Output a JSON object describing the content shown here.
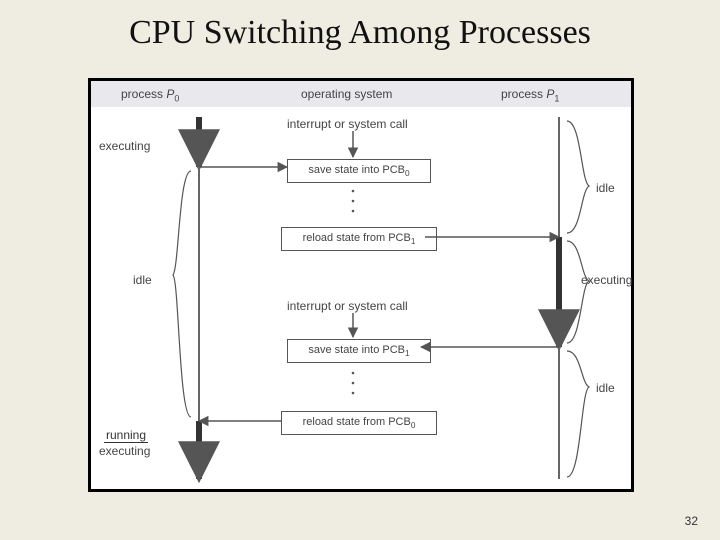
{
  "title": "CPU Switching Among Processes",
  "page_number": "32",
  "columns": {
    "p0": {
      "label": "process ",
      "sub": "P",
      "subnum": "0"
    },
    "os": "operating system",
    "p1": {
      "label": "process ",
      "sub": "P",
      "subnum": "1"
    }
  },
  "sidelabels": {
    "exec_p0": "executing",
    "idle_p0": "idle",
    "exec_p0_2": "executing",
    "exec_p1": "executing",
    "idle_p1_1": "idle",
    "idle_p1_2": "idle"
  },
  "events": {
    "int1": "interrupt or system call",
    "int2": "interrupt or system call"
  },
  "boxes": {
    "save0": {
      "t": "save state into PCB",
      "sub": "0"
    },
    "reload1": {
      "t": "reload state from PCB",
      "sub": "1"
    },
    "save1": {
      "t": "save state into PCB",
      "sub": "1"
    },
    "reload0": {
      "t": "reload state from PCB",
      "sub": "0"
    }
  },
  "annot": {
    "running": "running"
  }
}
